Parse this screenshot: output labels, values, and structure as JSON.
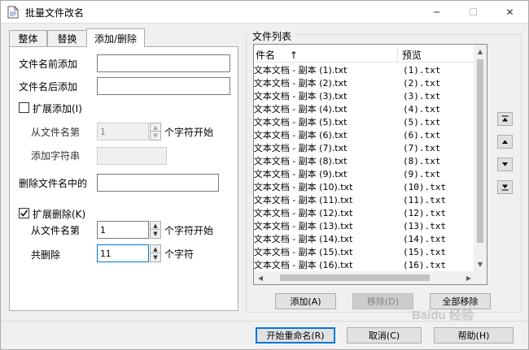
{
  "window": {
    "title": "批量文件改名",
    "minimize_glyph": "─",
    "maximize_glyph": "☐",
    "close_glyph": "✕"
  },
  "tabs": [
    {
      "label": "整体"
    },
    {
      "label": "替换"
    },
    {
      "label": "添加/删除"
    }
  ],
  "form": {
    "prefix_label": "文件名前添加",
    "prefix_value": "",
    "suffix_label": "文件名后添加",
    "suffix_value": "",
    "ext_add": {
      "checkbox_label": "扩展添加(I)",
      "checked": false,
      "from_label": "从文件名第",
      "from_value": "1",
      "from_unit": "个字符开始",
      "string_label": "添加字符串",
      "string_value": ""
    },
    "delete_label": "删除文件名中的",
    "delete_value": "",
    "ext_delete": {
      "checkbox_label": "扩展删除(K)",
      "checked": true,
      "from_label": "从文件名第",
      "from_value": "1",
      "from_unit": "个字符开始",
      "count_label": "共删除",
      "count_value": "11",
      "count_unit": "个字符"
    }
  },
  "file_list": {
    "group_title": "文件列表",
    "col_name": "件名",
    "sort_glyph": "↑",
    "col_preview": "预览",
    "rows": [
      {
        "name": "|文本文档 - 副本 (1).txt",
        "preview": "(1).txt"
      },
      {
        "name": "|文本文档 - 副本 (2).txt",
        "preview": "(2).txt"
      },
      {
        "name": "|文本文档 - 副本 (3).txt",
        "preview": "(3).txt"
      },
      {
        "name": "|文本文档 - 副本 (4).txt",
        "preview": "(4).txt"
      },
      {
        "name": "|文本文档 - 副本 (5).txt",
        "preview": "(5).txt"
      },
      {
        "name": "|文本文档 - 副本 (6).txt",
        "preview": "(6).txt"
      },
      {
        "name": "|文本文档 - 副本 (7).txt",
        "preview": "(7).txt"
      },
      {
        "name": "|文本文档 - 副本 (8).txt",
        "preview": "(8).txt"
      },
      {
        "name": "|文本文档 - 副本 (9).txt",
        "preview": "(9).txt"
      },
      {
        "name": "|文本文档 - 副本 (10).txt",
        "preview": "(10).txt"
      },
      {
        "name": "|文本文档 - 副本 (11).txt",
        "preview": "(11).txt"
      },
      {
        "name": "|文本文档 - 副本 (12).txt",
        "preview": "(12).txt"
      },
      {
        "name": "|文本文档 - 副本 (13).txt",
        "preview": "(13).txt"
      },
      {
        "name": "|文本文档 - 副本 (14).txt",
        "preview": "(14).txt"
      },
      {
        "name": "|文本文档 - 副本 (15).txt",
        "preview": "(15).txt"
      },
      {
        "name": "|文本文档 - 副本 (16).txt",
        "preview": "(16).txt"
      }
    ]
  },
  "move_buttons": [
    {
      "glyph": "⏶"
    },
    {
      "glyph": "▲"
    },
    {
      "glyph": "▼"
    },
    {
      "glyph": "⏷"
    }
  ],
  "list_buttons": {
    "add": "添加(A)",
    "remove": "移除(D)",
    "remove_all": "全部移除"
  },
  "footer": {
    "start": "开始重命名(R)",
    "cancel": "取消(C)",
    "help": "帮助(H)"
  },
  "watermark": "Baidu 经验"
}
